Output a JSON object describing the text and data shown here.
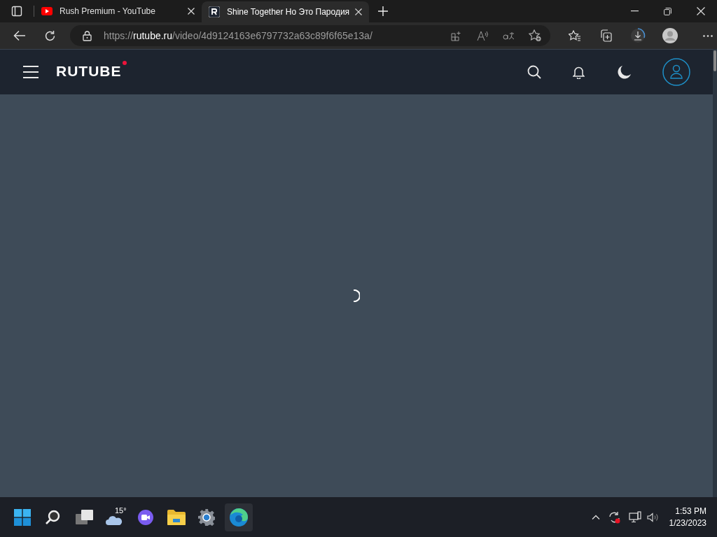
{
  "browser": {
    "tabs": [
      {
        "title": "Rush Premium - YouTube",
        "kind": "youtube",
        "selected": false
      },
      {
        "title": "Shine Together Но Это Пародия",
        "kind": "rutube",
        "selected": true
      }
    ],
    "address": {
      "scheme": "https://",
      "host": "rutube.ru",
      "path": "/video/4d9124163e6797732a63c89f6f65e13a/"
    }
  },
  "site_header": {
    "logo": "RUTUBE"
  },
  "content": {
    "loading": true
  },
  "taskbar": {
    "weather": "15°",
    "time": "1:53 PM",
    "date": "1/23/2023"
  }
}
